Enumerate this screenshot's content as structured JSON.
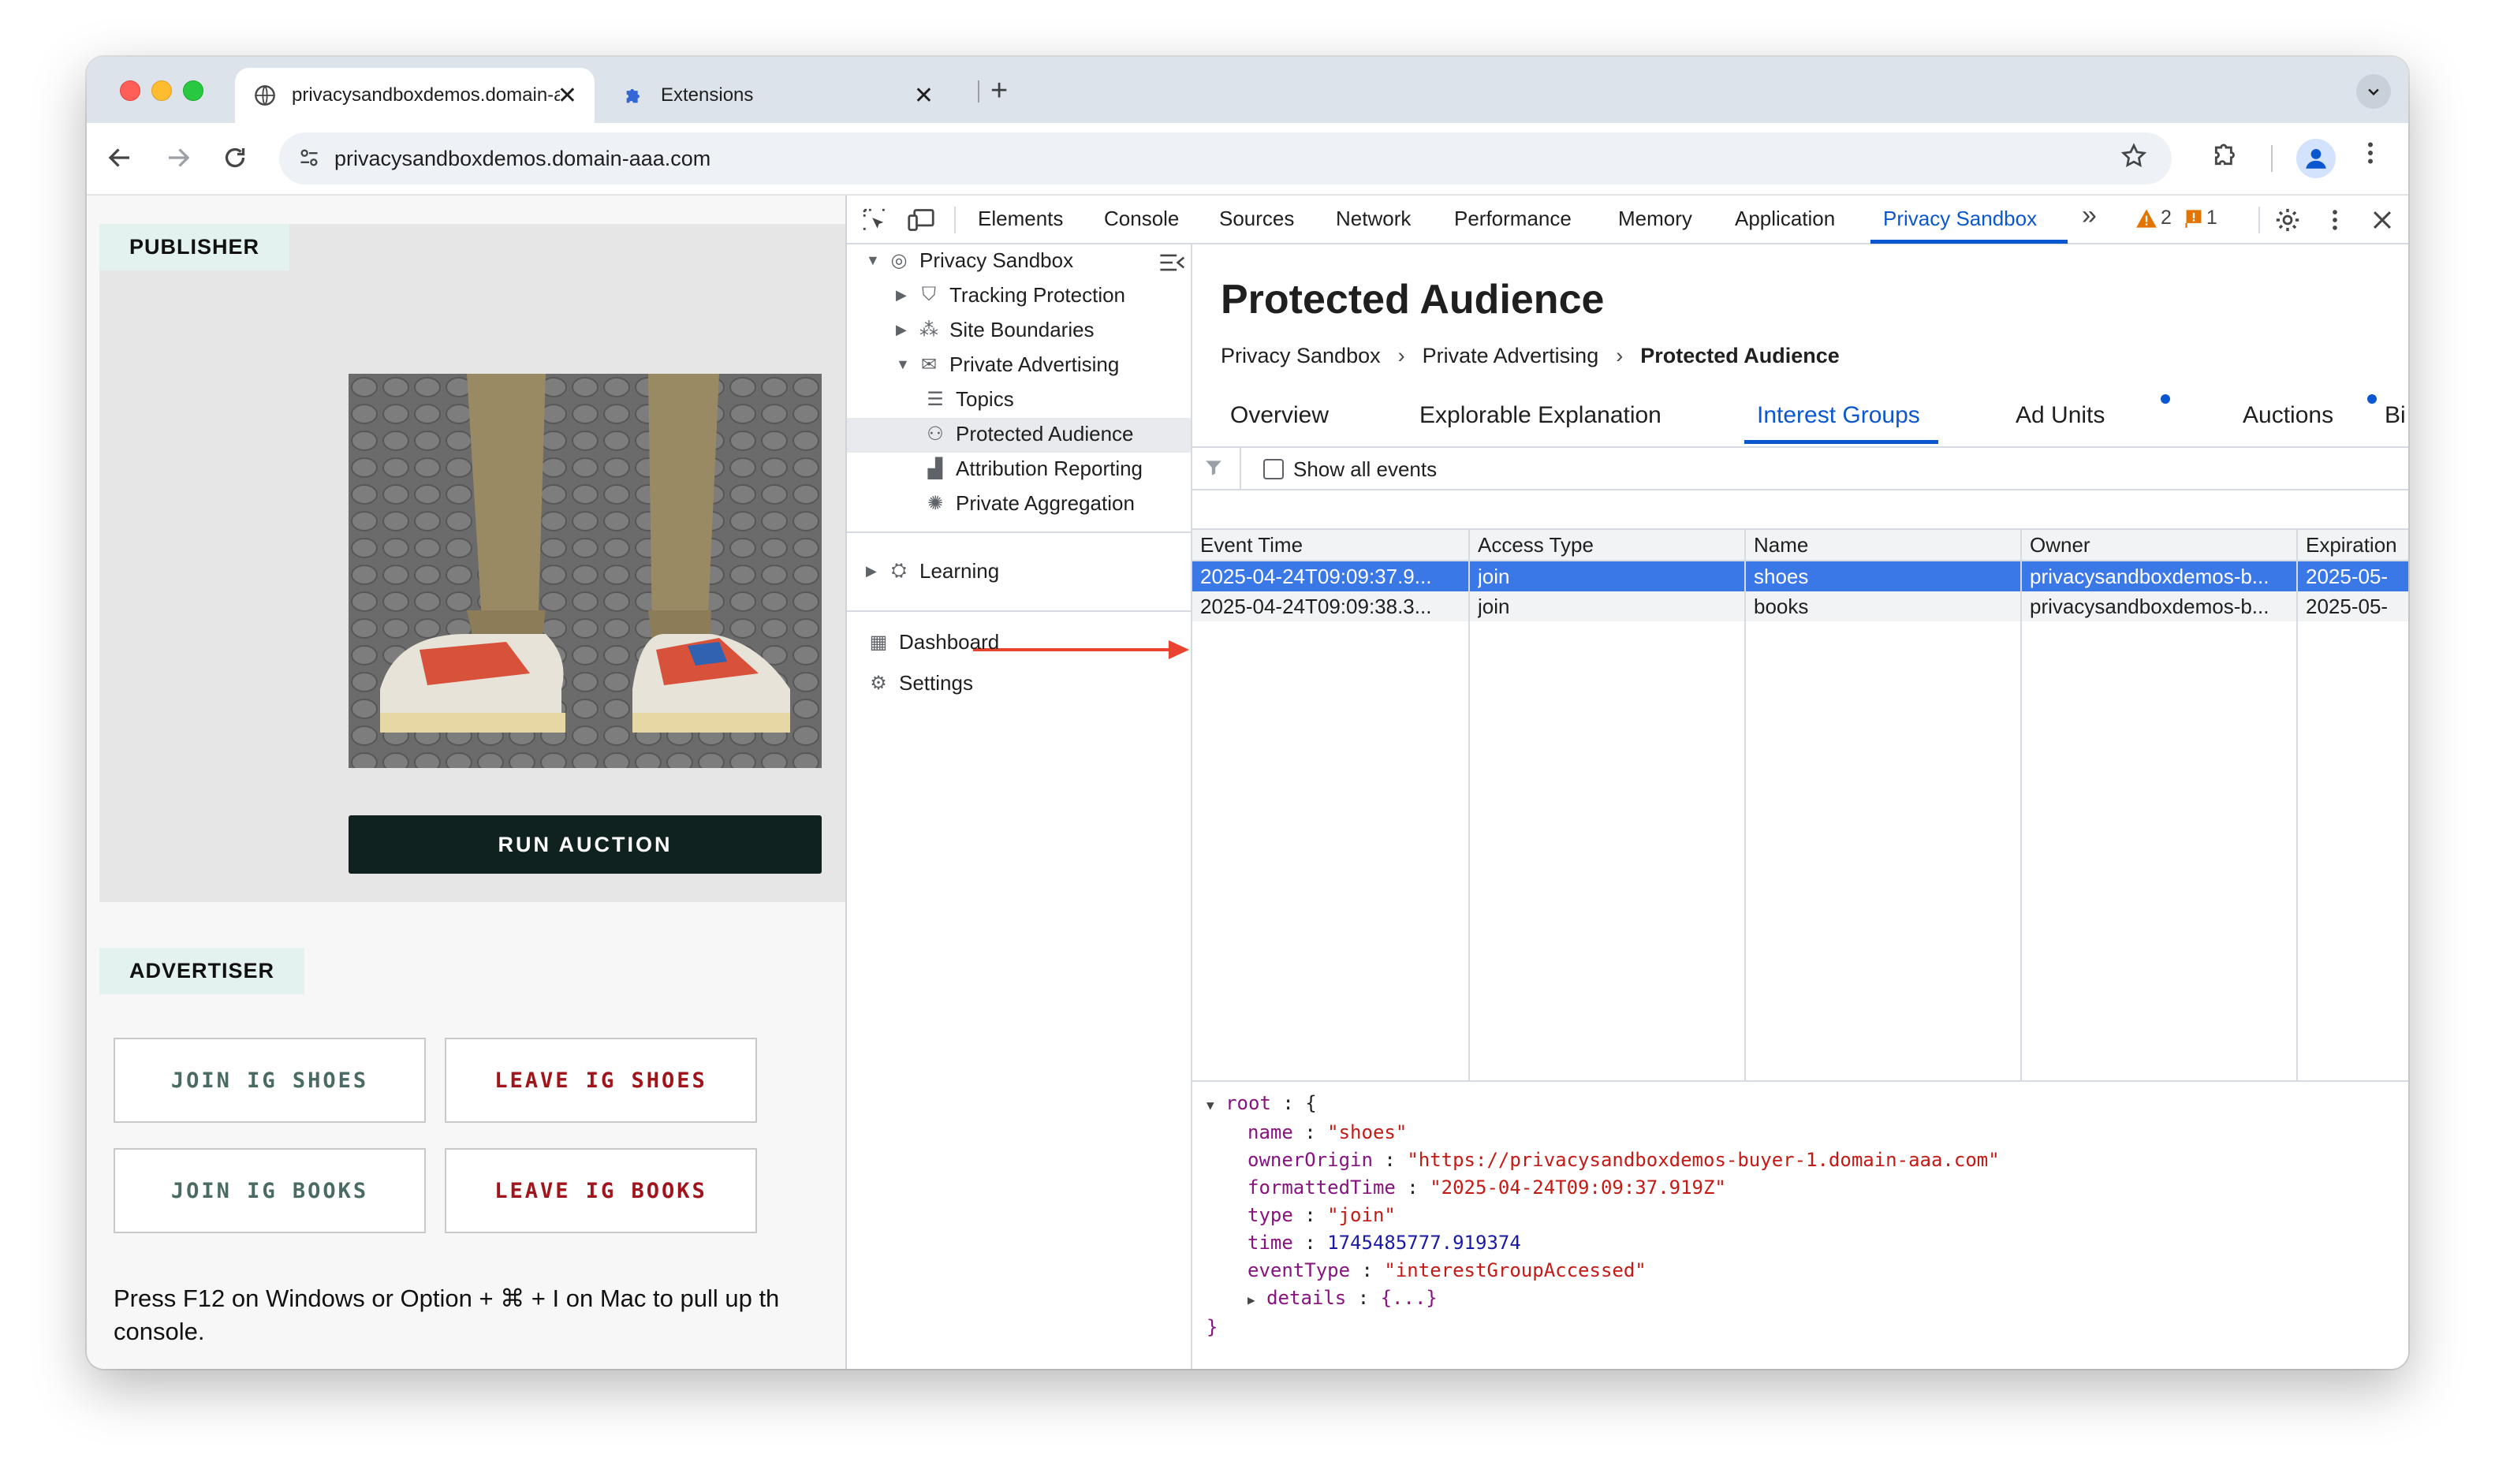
{
  "browser": {
    "tabs": [
      {
        "title": "privacysandboxdemos.domain-aaa.com",
        "active": true
      },
      {
        "title": "Extensions",
        "active": false
      }
    ],
    "close_glyph": "✕",
    "new_tab_glyph": "+",
    "url": "privacysandboxdemos.domain-aaa.com"
  },
  "page": {
    "publisher_label": "PUBLISHER",
    "run_auction_label": "RUN AUCTION",
    "advertiser_label": "ADVERTISER",
    "buttons": {
      "join_shoes": "JOIN IG SHOES",
      "leave_shoes": "LEAVE IG SHOES",
      "join_books": "JOIN IG BOOKS",
      "leave_books": "LEAVE IG BOOKS"
    },
    "help_line1": "Press F12 on Windows or Option + ⌘ + I on Mac to pull up th",
    "help_line2": "console."
  },
  "devtools": {
    "tabs": [
      "Elements",
      "Console",
      "Sources",
      "Network",
      "Performance",
      "Memory",
      "Application",
      "Privacy Sandbox"
    ],
    "active_tab": "Privacy Sandbox",
    "more_tabs_glyph": "»",
    "warning_count": "2",
    "issue_count": "1",
    "sidebar": {
      "root": "Privacy Sandbox",
      "items": [
        "Tracking Protection",
        "Site Boundaries",
        "Private Advertising"
      ],
      "sub_items": [
        "Topics",
        "Protected Audience",
        "Attribution Reporting",
        "Private Aggregation"
      ],
      "learning": "Learning",
      "dashboard": "Dashboard",
      "settings": "Settings"
    },
    "panel": {
      "title": "Protected Audience",
      "breadcrumb": [
        "Privacy Sandbox",
        "Private Advertising",
        "Protected Audience"
      ],
      "subtabs": [
        "Overview",
        "Explorable Explanation",
        "Interest Groups",
        "Ad Units",
        "Auctions",
        "Bi"
      ],
      "active_subtab": "Interest Groups",
      "show_all_events_label": "Show all events",
      "columns": [
        "Event Time",
        "Access Type",
        "Name",
        "Owner",
        "Expiration"
      ],
      "rows": [
        {
          "event_time": "2025-04-24T09:09:37.9...",
          "access_type": "join",
          "name": "shoes",
          "owner": "privacysandboxdemos-b...",
          "expiration": "2025-05-"
        },
        {
          "event_time": "2025-04-24T09:09:38.3...",
          "access_type": "join",
          "name": "books",
          "owner": "privacysandboxdemos-b...",
          "expiration": "2025-05-"
        }
      ],
      "json": {
        "root_key": "root",
        "name": "\"shoes\"",
        "ownerOrigin": "\"https://privacysandboxdemos-buyer-1.domain-aaa.com\"",
        "formattedTime": "\"2025-04-24T09:09:37.919Z\"",
        "type": "\"join\"",
        "time": "1745485777.919374",
        "eventType": "\"interestGroupAccessed\"",
        "details": "{...}"
      }
    }
  },
  "colors": {
    "accent": "#0b57d0",
    "selected_row": "#3b78e7",
    "run_button": "#10221f",
    "leave_text": "#a1141b",
    "join_text": "#4a6b63",
    "arrow": "#e8442e"
  }
}
